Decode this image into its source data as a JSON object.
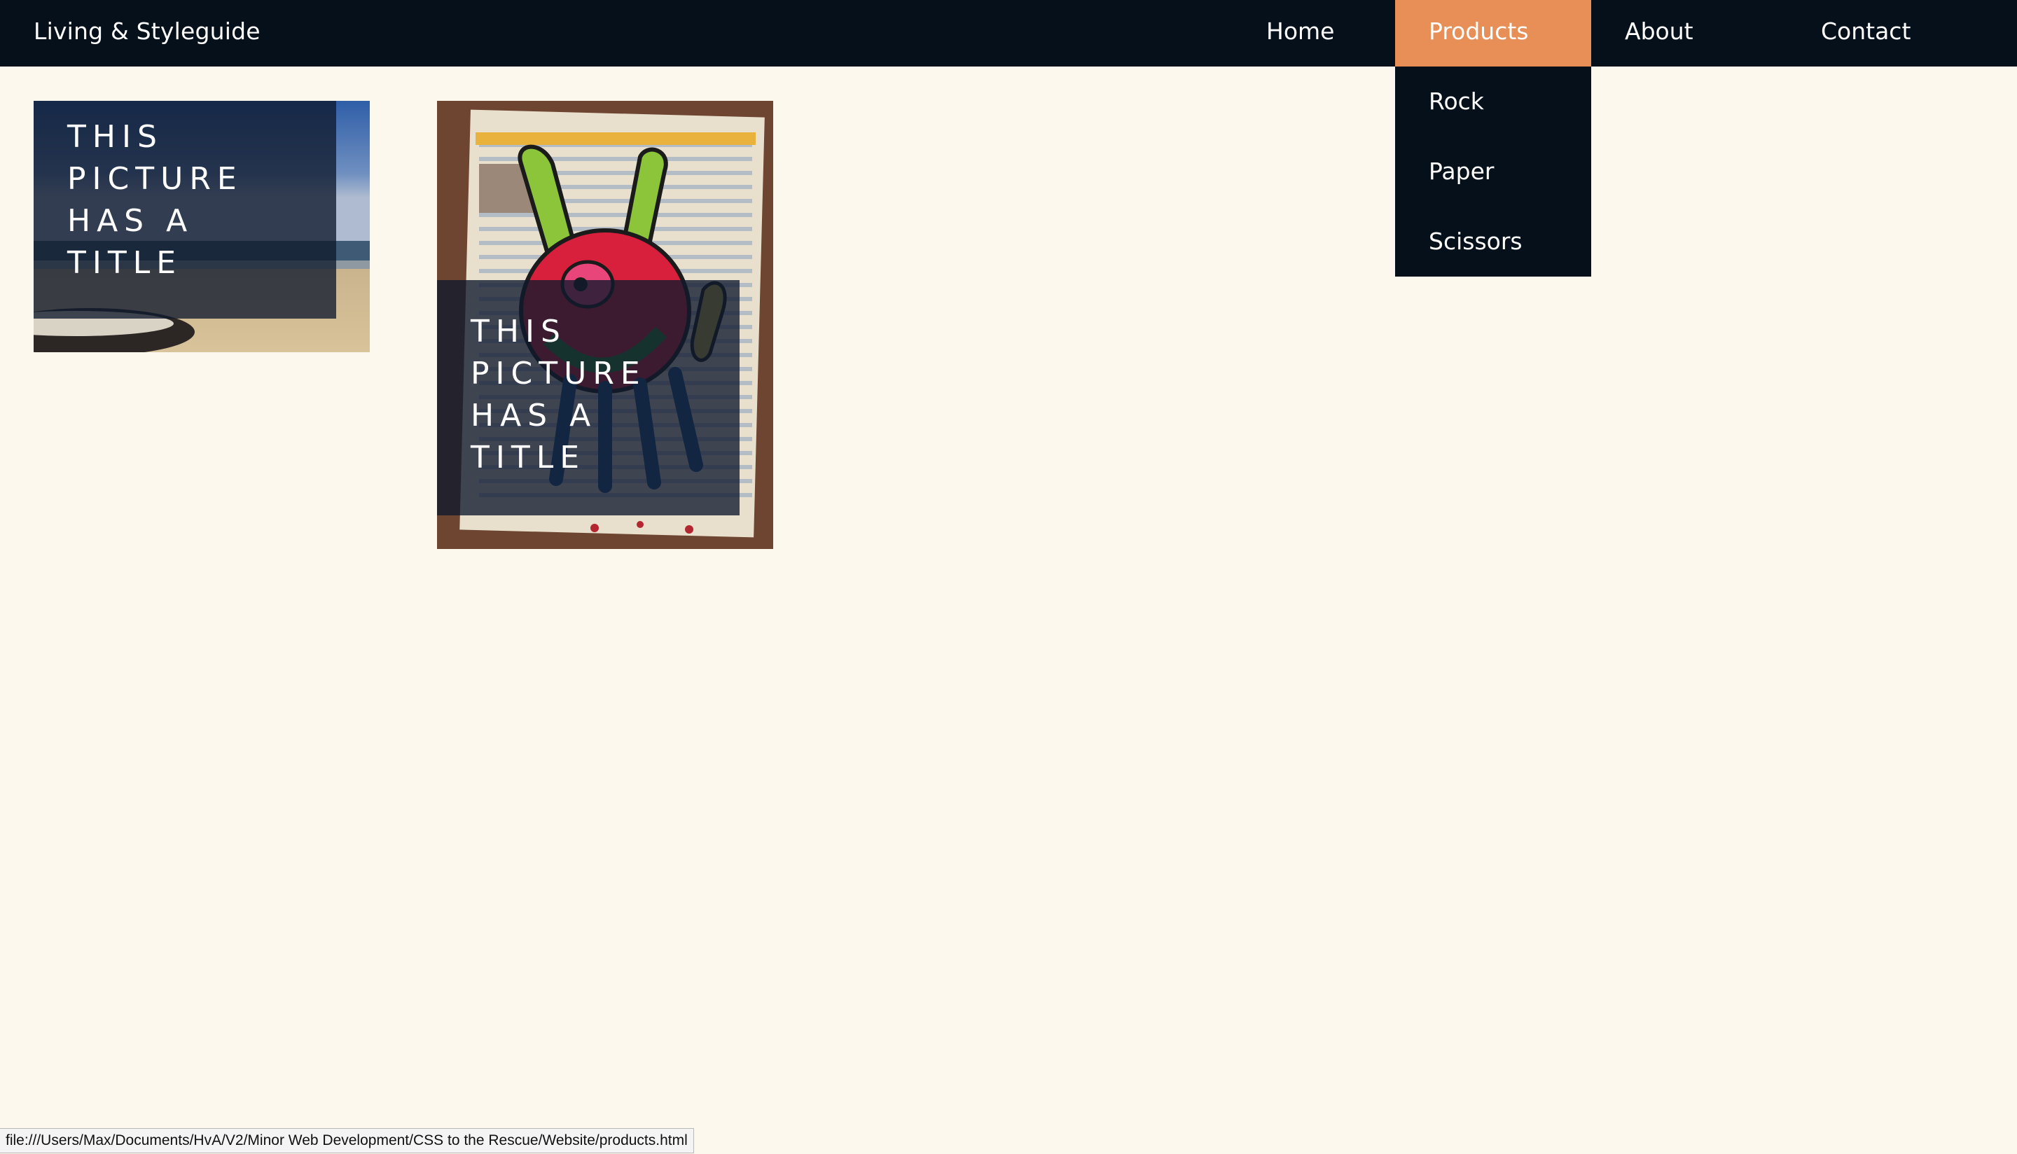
{
  "colors": {
    "navbar_bg": "#05101b",
    "page_bg": "#fdf8ee",
    "accent_active": "#e88f58",
    "caption_overlay": "#0f192d"
  },
  "navbar": {
    "brand": "Living & Styleguide",
    "items": [
      {
        "label": "Home",
        "active": false
      },
      {
        "label": "Products",
        "active": true
      },
      {
        "label": "About",
        "active": false
      },
      {
        "label": "Contact",
        "active": false
      }
    ]
  },
  "products_dropdown": {
    "items": [
      {
        "label": "Rock"
      },
      {
        "label": "Paper"
      },
      {
        "label": "Scissors"
      }
    ]
  },
  "cards": [
    {
      "image": "beach-photo",
      "caption_lines": [
        "THIS",
        "PICTURE",
        "HAS A",
        "TITLE"
      ]
    },
    {
      "image": "monster-drawing-photo",
      "caption_lines": [
        "THIS",
        "PICTURE",
        "HAS A",
        "TITLE"
      ]
    }
  ],
  "status_bar": {
    "url": "file:///Users/Max/Documents/HvA/V2/Minor Web Development/CSS to the Rescue/Website/products.html"
  }
}
